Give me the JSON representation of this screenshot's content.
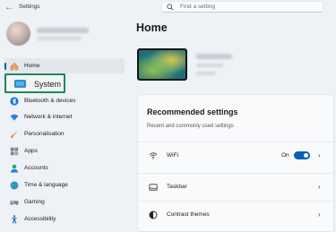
{
  "window": {
    "title": "Settings"
  },
  "search": {
    "placeholder": "Find a setting"
  },
  "sidebar": {
    "items": [
      {
        "label": "Home",
        "icon": "home-icon"
      },
      {
        "label": "System",
        "icon": "monitor-icon"
      },
      {
        "label": "Bluetooth & devices",
        "icon": "bluetooth-icon"
      },
      {
        "label": "Network & internet",
        "icon": "wifi-icon"
      },
      {
        "label": "Personalisation",
        "icon": "brush-icon"
      },
      {
        "label": "Apps",
        "icon": "apps-icon"
      },
      {
        "label": "Accounts",
        "icon": "person-icon"
      },
      {
        "label": "Time & language",
        "icon": "globe-icon"
      },
      {
        "label": "Gaming",
        "icon": "gamepad-icon"
      },
      {
        "label": "Accessibility",
        "icon": "accessibility-icon"
      }
    ]
  },
  "main": {
    "title": "Home",
    "recommended": {
      "title": "Recommended settings",
      "subtitle": "Recent and commonly used settings",
      "rows": [
        {
          "label": "WiFi",
          "state": "On",
          "icon": "wifi-icon"
        },
        {
          "label": "Taskbar",
          "icon": "taskbar-icon"
        },
        {
          "label": "Contrast themes",
          "icon": "contrast-icon"
        }
      ]
    }
  },
  "colors": {
    "accent": "#0a5fb4",
    "highlight_border": "#1d8a5c",
    "background": "#eef2f6"
  }
}
